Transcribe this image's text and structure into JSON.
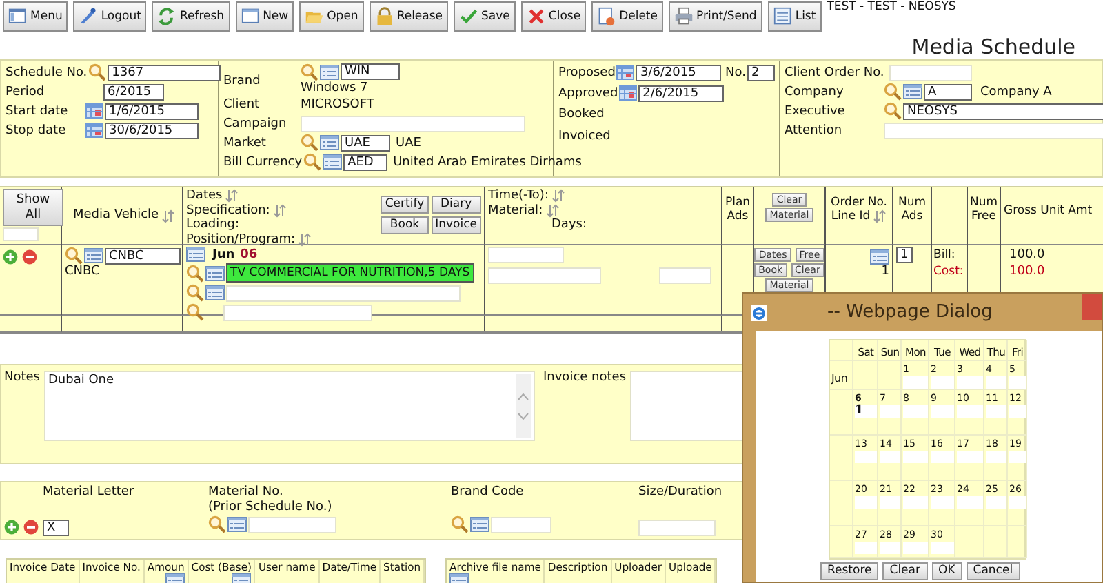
{
  "toolbar": [
    {
      "label": "Menu",
      "kind": "menu"
    },
    {
      "label": "Logout",
      "kind": "logout"
    },
    {
      "label": "Refresh",
      "kind": "refresh"
    },
    {
      "label": "New",
      "kind": "new"
    },
    {
      "label": "Open",
      "kind": "open"
    },
    {
      "label": "Release",
      "kind": "release"
    },
    {
      "label": "Save",
      "kind": "save"
    },
    {
      "label": "Close",
      "kind": "close"
    },
    {
      "label": "Delete",
      "kind": "delete"
    },
    {
      "label": "Print/Send",
      "kind": "print"
    },
    {
      "label": "List",
      "kind": "list"
    }
  ],
  "environment": "TEST - TEST - NEOSYS",
  "title": "Media Schedule",
  "header": {
    "schedule_no": {
      "label": "Schedule No.",
      "value": "1367"
    },
    "period": {
      "label": "Period",
      "value": "6/2015"
    },
    "start_date": {
      "label": "Start date",
      "value": "1/6/2015"
    },
    "stop_date": {
      "label": "Stop date",
      "value": "30/6/2015"
    },
    "brand": {
      "label": "Brand",
      "code": "WIN",
      "name": "Windows 7"
    },
    "client": {
      "label": "Client",
      "value": "MICROSOFT"
    },
    "campaign": {
      "label": "Campaign"
    },
    "market": {
      "label": "Market",
      "code": "UAE",
      "name": "UAE"
    },
    "bill_currency": {
      "label": "Bill Currency",
      "code": "AED",
      "name": "United Arab Emirates Dirhams"
    },
    "proposed": {
      "label": "Proposed",
      "value": "3/6/2015"
    },
    "number": {
      "label": "No.",
      "value": "2"
    },
    "approved": {
      "label": "Approved",
      "value": "2/6/2015"
    },
    "booked": {
      "label": "Booked"
    },
    "invoiced": {
      "label": "Invoiced"
    },
    "client_order_no": {
      "label": "Client Order No."
    },
    "company": {
      "label": "Company",
      "code": "A",
      "name": "Company A"
    },
    "executive": {
      "label": "Executive",
      "value": "NEOSYS"
    },
    "attention": {
      "label": "Attention"
    }
  },
  "schedule_table": {
    "show_all": "Show All",
    "vehicle_header": "Media Vehicle",
    "dates_header": [
      {
        "text": "Dates",
        "sortable": true
      },
      {
        "text": "Specification:",
        "sortable": true
      },
      {
        "text": "Loading:",
        "sortable": false
      },
      {
        "text": "Position/Program:",
        "sortable": true
      }
    ],
    "dates_buttons": [
      "Certify",
      "Diary",
      "Book",
      "Invoice"
    ],
    "time_header": [
      {
        "text": "Time(-To):",
        "sortable": true
      },
      {
        "text": "Material:",
        "sortable": true
      }
    ],
    "days_label": "Days:",
    "plan_ads_header": "Plan Ads",
    "header_buttons": [
      "Clear",
      "Material"
    ],
    "order_header": [
      "Order No.",
      "Line Id"
    ],
    "num_ads_header": "Num Ads",
    "num_free_header": "Num Free",
    "gross_header": "Gross Unit Amt",
    "rows": [
      {
        "vehicle_code": "CNBC",
        "vehicle_name": "CNBC",
        "month": "Jun",
        "day": "06",
        "specification": "TV COMMERCIAL FOR NUTRITION,5 DAYS",
        "highlighted": true,
        "row_buttons": [
          "Dates",
          "Free",
          "Book",
          "Clear",
          "Material"
        ],
        "line_id": "1",
        "num_ads": "1",
        "bill_label": "Bill:",
        "cost_label": "Cost:",
        "bill_amount": "100.0",
        "cost_amount": "100.0"
      }
    ]
  },
  "notes": {
    "label": "Notes",
    "value": "Dubai One",
    "invoice_label": "Invoice notes"
  },
  "materials": {
    "headers": [
      "Material Letter",
      "Material No.",
      "(Prior Schedule No.)",
      "Brand Code",
      "Size/Duration"
    ],
    "rows": [
      {
        "letter": "X"
      }
    ]
  },
  "invoices": {
    "columns": [
      "Invoice Date",
      "Invoice No.",
      "Amoun",
      "Cost (Base)",
      "User name",
      "Date/Time",
      "Station"
    ]
  },
  "archive": {
    "columns": [
      "Archive file name",
      "Description",
      "Uploader",
      "Uploade"
    ]
  },
  "dialog": {
    "title": "-- Webpage Dialog",
    "weekdays": [
      "Sat",
      "Sun",
      "Mon",
      "Tue",
      "Wed",
      "Thu",
      "Fri"
    ],
    "month": "Jun",
    "weeks": [
      [
        {
          "kind": "blank"
        },
        {
          "kind": "blank"
        },
        {
          "kind": "day",
          "label": "1",
          "selected": false
        },
        {
          "kind": "day",
          "label": "2",
          "selected": false
        },
        {
          "kind": "day",
          "label": "3",
          "selected": false
        },
        {
          "kind": "day",
          "label": "4",
          "selected": false
        },
        {
          "kind": "day",
          "label": "5",
          "selected": false
        }
      ],
      [
        {
          "kind": "day",
          "label": "6",
          "selected": true,
          "value": "1"
        },
        {
          "kind": "day",
          "label": "7",
          "selected": false
        },
        {
          "kind": "day",
          "label": "8",
          "selected": false
        },
        {
          "kind": "day",
          "label": "9",
          "selected": false
        },
        {
          "kind": "day",
          "label": "10",
          "selected": false
        },
        {
          "kind": "day",
          "label": "11",
          "selected": false
        },
        {
          "kind": "day",
          "label": "12",
          "selected": false
        }
      ],
      [
        {
          "kind": "day",
          "label": "13",
          "selected": false
        },
        {
          "kind": "day",
          "label": "14",
          "selected": false
        },
        {
          "kind": "day",
          "label": "15",
          "selected": false
        },
        {
          "kind": "day",
          "label": "16",
          "selected": false
        },
        {
          "kind": "day",
          "label": "17",
          "selected": false
        },
        {
          "kind": "day",
          "label": "18",
          "selected": false
        },
        {
          "kind": "day",
          "label": "19",
          "selected": false
        }
      ],
      [
        {
          "kind": "day",
          "label": "20",
          "selected": false
        },
        {
          "kind": "day",
          "label": "21",
          "selected": false
        },
        {
          "kind": "day",
          "label": "22",
          "selected": false
        },
        {
          "kind": "day",
          "label": "23",
          "selected": false
        },
        {
          "kind": "day",
          "label": "24",
          "selected": false
        },
        {
          "kind": "day",
          "label": "25",
          "selected": false
        },
        {
          "kind": "day",
          "label": "26",
          "selected": false
        }
      ],
      [
        {
          "kind": "day",
          "label": "27",
          "selected": false
        },
        {
          "kind": "day",
          "label": "28",
          "selected": false
        },
        {
          "kind": "day",
          "label": "29",
          "selected": false
        },
        {
          "kind": "day",
          "label": "30",
          "selected": false
        },
        {
          "kind": "blank"
        },
        {
          "kind": "blank"
        },
        {
          "kind": "blank"
        }
      ]
    ],
    "buttons": [
      "Restore",
      "Clear",
      "OK",
      "Cancel"
    ]
  }
}
